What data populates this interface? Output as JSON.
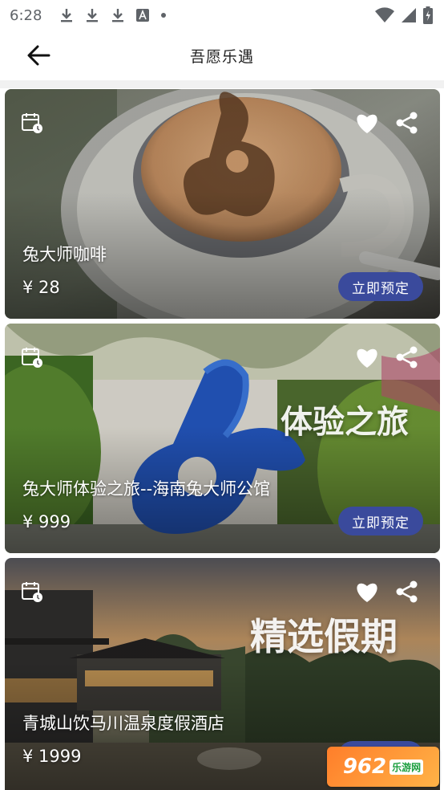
{
  "status_bar": {
    "time": "6:28",
    "left_icons": [
      "download-icon",
      "download-icon",
      "download-icon",
      "font-icon",
      "dot-icon"
    ],
    "right_icons": [
      "wifi-icon",
      "signal-icon",
      "battery-charging-icon"
    ]
  },
  "app_bar": {
    "title": "吾愿乐遇",
    "back_icon": "arrow-left-icon"
  },
  "cards": [
    {
      "title": "兔大师咖啡",
      "price": "¥ 28",
      "button": "立即预定",
      "overlay_text": ""
    },
    {
      "title": "兔大师体验之旅--海南兔大师公馆",
      "price": "¥ 999",
      "button": "立即预定",
      "overlay_text": "体验之旅"
    },
    {
      "title": "青城山饮马川温泉度假酒店",
      "price": "¥ 1999",
      "button": "立即预定",
      "overlay_text": "精选假期"
    }
  ],
  "watermark": {
    "text": "962",
    "sub": "乐游网"
  },
  "colors": {
    "accent": "#3a4a9c",
    "divider": "#f1f1f1"
  }
}
